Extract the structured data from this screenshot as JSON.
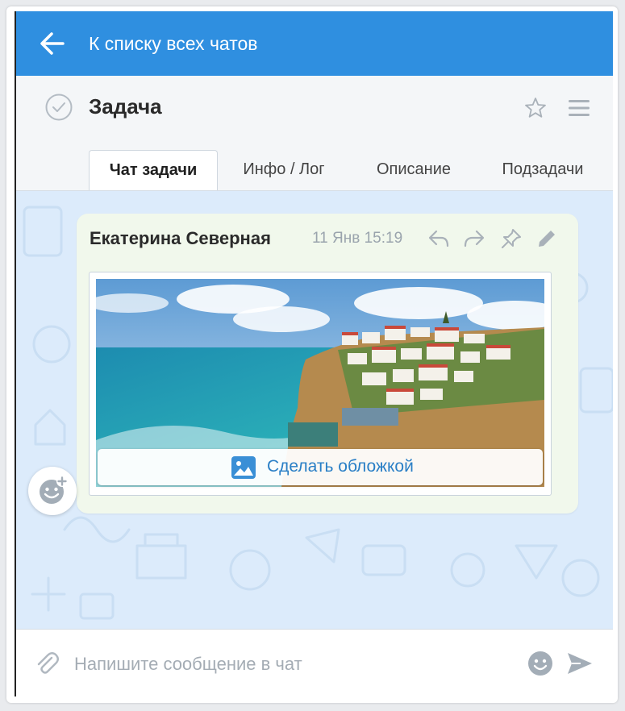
{
  "topbar": {
    "back_label": "К списку всех чатов",
    "color": "#2f8fe0"
  },
  "task": {
    "title": "Задача",
    "tabs": [
      {
        "label": "Чат задачи",
        "active": true
      },
      {
        "label": "Инфо / Лог",
        "active": false
      },
      {
        "label": "Описание",
        "active": false
      },
      {
        "label": "Подзадачи",
        "active": false
      }
    ]
  },
  "message": {
    "author": "Екатерина Северная",
    "time": "11 Янв 15:19",
    "actions": [
      "reply-icon",
      "forward-icon",
      "pin-icon",
      "edit-icon"
    ],
    "attachment": {
      "cover_button_label": "Сделать обложкой"
    }
  },
  "composer": {
    "placeholder": "Напишите сообщение в чат"
  },
  "colors": {
    "accent": "#2f8fe0",
    "chat_bg": "#dcebfb",
    "bubble_bg": "#f1f8ec",
    "link": "#2a7fc6"
  }
}
